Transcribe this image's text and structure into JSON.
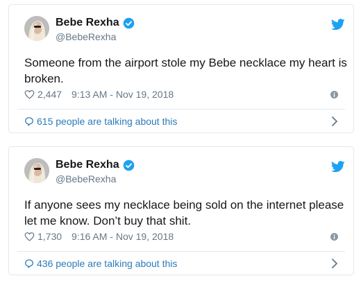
{
  "colors": {
    "accent": "#1da1f2",
    "link": "#2b7bb9",
    "text": "#14171a",
    "muted": "#657786",
    "border": "#e1e8ed"
  },
  "tweets": [
    {
      "name": "Bebe Rexha",
      "handle": "@BebeRexha",
      "text": "Someone from the airport stole my Bebe necklace my heart is broken.",
      "likes": "2,447",
      "timestamp": "9:13 AM - Nov 19, 2018",
      "talking": "615 people are talking about this",
      "icons": [
        "verified-icon",
        "twitter-bird-icon",
        "heart-icon",
        "info-icon",
        "reply-bubble-icon",
        "chevron-right-icon"
      ]
    },
    {
      "name": "Bebe Rexha",
      "handle": "@BebeRexha",
      "text": "If anyone sees my necklace being sold on the internet please let me know. Don’t buy that shit.",
      "likes": "1,730",
      "timestamp": "9:16 AM - Nov 19, 2018",
      "talking": "436 people are talking about this",
      "icons": [
        "verified-icon",
        "twitter-bird-icon",
        "heart-icon",
        "info-icon",
        "reply-bubble-icon",
        "chevron-right-icon"
      ]
    }
  ]
}
